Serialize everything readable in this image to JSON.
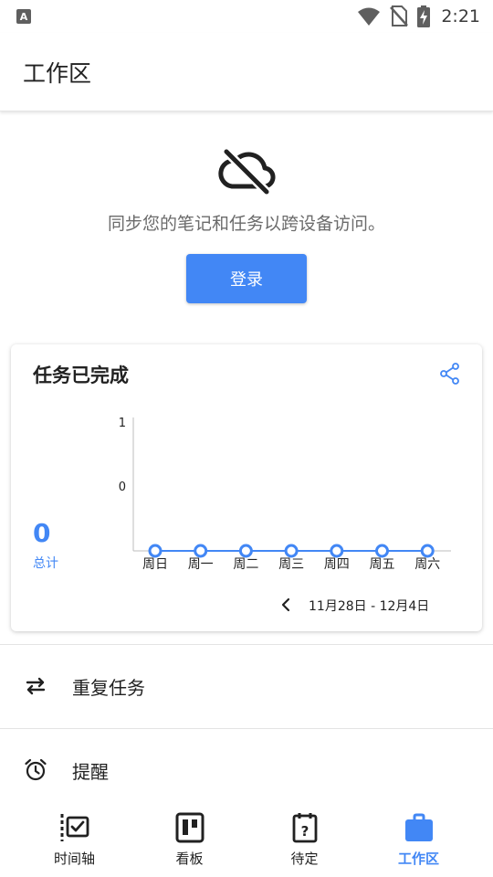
{
  "status_bar": {
    "notification_icon": "A",
    "time": "2:21",
    "icons": [
      "wifi-icon",
      "no-sim-icon",
      "battery-charging-icon"
    ]
  },
  "app_bar": {
    "title": "工作区"
  },
  "sync": {
    "icon": "cloud-off-icon",
    "message": "同步您的笔记和任务以跨设备访问。",
    "login_label": "登录"
  },
  "stats_card": {
    "title": "任务已完成",
    "share_icon": "share-icon",
    "total_value": "0",
    "total_label": "总计",
    "date_range": "11月28日 - 12月4日"
  },
  "chart_data": {
    "type": "line",
    "categories": [
      "周日",
      "周一",
      "周二",
      "周三",
      "周四",
      "周五",
      "周六"
    ],
    "series": [
      {
        "values": [
          0,
          0,
          0,
          0,
          0,
          0,
          0
        ]
      }
    ],
    "y_tick_labels": [
      "1",
      "0"
    ],
    "ylim": [
      0,
      1
    ],
    "grid": false,
    "color": "#4287f5"
  },
  "list": {
    "items": [
      {
        "label": "重复任务",
        "icon": "repeat-icon"
      },
      {
        "label": "提醒",
        "icon": "alarm-icon"
      }
    ]
  },
  "bottom_nav": {
    "items": [
      {
        "label": "时间轴",
        "icon": "timeline-icon"
      },
      {
        "label": "看板",
        "icon": "kanban-icon"
      },
      {
        "label": "待定",
        "icon": "pending-icon"
      },
      {
        "label": "工作区",
        "icon": "workspace-icon",
        "active": true
      }
    ]
  },
  "colors": {
    "accent": "#4287f5",
    "text_primary": "#212121",
    "text_secondary": "#6b6b6b"
  }
}
